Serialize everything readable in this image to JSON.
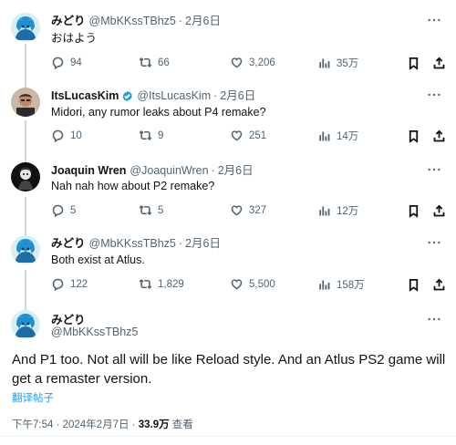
{
  "tweets": [
    {
      "name": "みどり",
      "handle": "@MbKKssTBhz5",
      "separator": "·",
      "date": "2月6日",
      "text": "おはよう",
      "replies": "94",
      "retweets": "66",
      "likes": "3,206",
      "views": "35万",
      "avatar": "blue-anime-avatar"
    },
    {
      "name": "ItsLucasKim",
      "handle": "@ItsLucasKim",
      "separator": "·",
      "date": "2月6日",
      "text": "Midori, any rumor leaks about P4 remake?",
      "replies": "10",
      "retweets": "9",
      "likes": "251",
      "views": "14万",
      "verified": true,
      "avatar": "person-avatar"
    },
    {
      "name": "Joaquin Wren",
      "handle": "@JoaquinWren",
      "separator": "·",
      "date": "2月6日",
      "text": "Nah nah how about P2 remake?",
      "replies": "5",
      "retweets": "5",
      "likes": "327",
      "views": "12万",
      "avatar": "dark-anime-avatar"
    },
    {
      "name": "みどり",
      "handle": "@MbKKssTBhz5",
      "separator": "·",
      "date": "2月6日",
      "text": "Both exist at Atlus.",
      "replies": "122",
      "retweets": "1,829",
      "likes": "5,500",
      "views": "158万",
      "avatar": "blue-anime-avatar"
    }
  ],
  "main_tweet": {
    "name": "みどり",
    "handle": "@MbKKssTBhz5",
    "text": "And P1 too. Not all will be like Reload style. And an Atlus PS2 game will get a remaster version.",
    "translate_label": "翻译帖子",
    "time": "下午7:54 · 2024年2月7日 · ",
    "views_count": "33.9万",
    "views_label": " 查看"
  },
  "colors": {
    "accent": "#1d9bf0",
    "muted": "#536471",
    "thread_line": "#cfd9de"
  }
}
